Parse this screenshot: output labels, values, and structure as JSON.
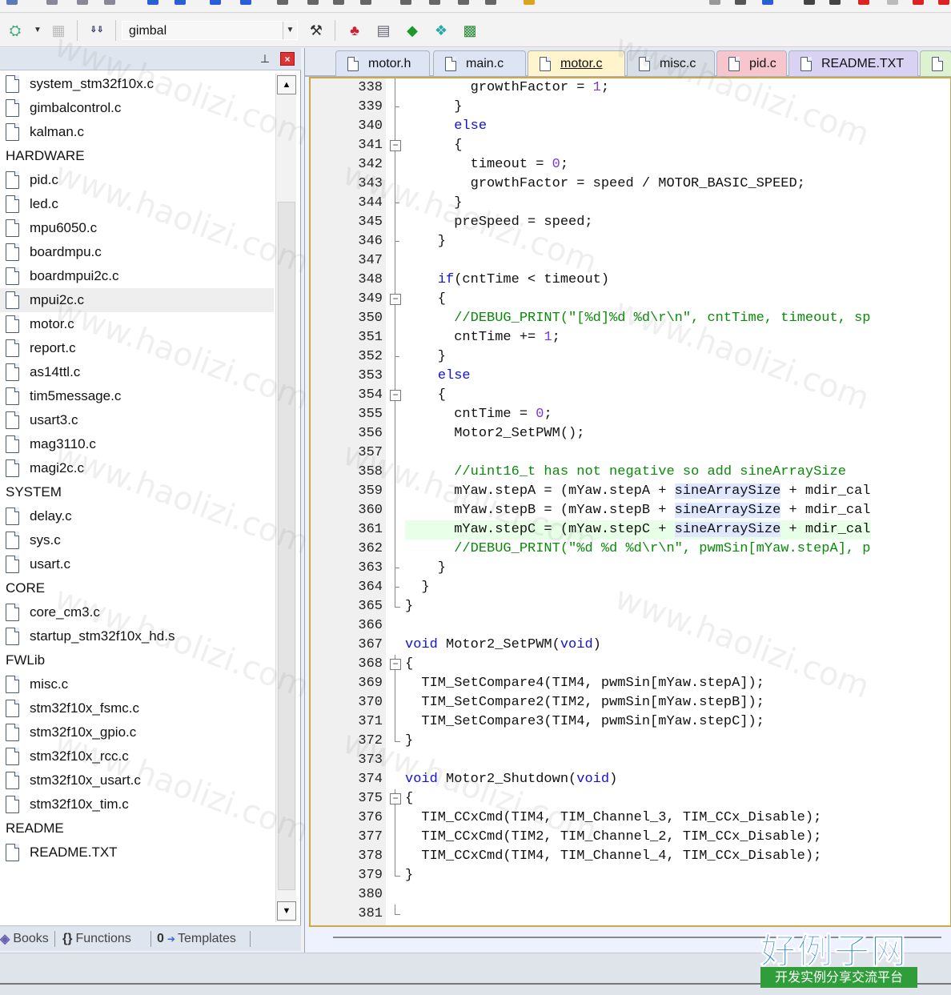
{
  "toolbar": {
    "target_name": "gimbal",
    "icons": [
      "build-options-icon",
      "load-icon",
      "magic-wand-icon",
      "rte-manage-icon",
      "pack-installer-icon",
      "select-device-icon",
      "packs-icon"
    ]
  },
  "project_panel": {
    "items": [
      {
        "type": "file",
        "label": "system_stm32f10x.c"
      },
      {
        "type": "file",
        "label": "gimbalcontrol.c"
      },
      {
        "type": "file",
        "label": "kalman.c"
      },
      {
        "type": "group",
        "label": "HARDWARE"
      },
      {
        "type": "file",
        "label": "pid.c"
      },
      {
        "type": "file",
        "label": "led.c"
      },
      {
        "type": "file",
        "label": "mpu6050.c"
      },
      {
        "type": "file",
        "label": "boardmpu.c"
      },
      {
        "type": "file",
        "label": "boardmpui2c.c"
      },
      {
        "type": "file",
        "label": "mpui2c.c",
        "selected": true
      },
      {
        "type": "file",
        "label": "motor.c"
      },
      {
        "type": "file",
        "label": "report.c"
      },
      {
        "type": "file",
        "label": "as14ttl.c"
      },
      {
        "type": "file",
        "label": "tim5message.c"
      },
      {
        "type": "file",
        "label": "usart3.c"
      },
      {
        "type": "file",
        "label": "mag3110.c"
      },
      {
        "type": "file",
        "label": "magi2c.c"
      },
      {
        "type": "group",
        "label": "SYSTEM"
      },
      {
        "type": "file",
        "label": "delay.c"
      },
      {
        "type": "file",
        "label": "sys.c"
      },
      {
        "type": "file",
        "label": "usart.c"
      },
      {
        "type": "group",
        "label": "CORE"
      },
      {
        "type": "file",
        "label": "core_cm3.c"
      },
      {
        "type": "file",
        "label": "startup_stm32f10x_hd.s"
      },
      {
        "type": "group",
        "label": "FWLib"
      },
      {
        "type": "file",
        "label": "misc.c"
      },
      {
        "type": "file",
        "label": "stm32f10x_fsmc.c"
      },
      {
        "type": "file",
        "label": "stm32f10x_gpio.c"
      },
      {
        "type": "file",
        "label": "stm32f10x_rcc.c"
      },
      {
        "type": "file",
        "label": "stm32f10x_usart.c"
      },
      {
        "type": "file",
        "label": "stm32f10x_tim.c"
      },
      {
        "type": "group",
        "label": "README"
      },
      {
        "type": "file",
        "label": "README.TXT"
      }
    ],
    "bottom_tabs": [
      {
        "label": "Books",
        "glyph": ""
      },
      {
        "label": "Functions",
        "glyph": "{}"
      },
      {
        "label": "Templates",
        "glyph": "0"
      }
    ]
  },
  "editor": {
    "tabs": [
      {
        "label": "motor.h",
        "color": "#dde5f5"
      },
      {
        "label": "main.c",
        "color": "#dde5f5"
      },
      {
        "label": "motor.c",
        "color": "#fff4cc",
        "active": true
      },
      {
        "label": "misc.c",
        "color": "#d8dde6"
      },
      {
        "label": "pid.c",
        "color": "#f6c6cc"
      },
      {
        "label": "README.TXT",
        "color": "#d9d2f2"
      },
      {
        "label": "",
        "color": "#dff2d0"
      }
    ],
    "lines": [
      {
        "n": "338",
        "fold": "line",
        "text": "        growthFactor = 1;"
      },
      {
        "n": "339",
        "fold": "tick",
        "text": "      }"
      },
      {
        "n": "340",
        "fold": "line",
        "text": "      else"
      },
      {
        "n": "341",
        "fold": "box",
        "text": "      {"
      },
      {
        "n": "342",
        "fold": "line",
        "text": "        timeout = 0;"
      },
      {
        "n": "343",
        "fold": "line",
        "text": "        growthFactor = speed / MOTOR_BASIC_SPEED;"
      },
      {
        "n": "344",
        "fold": "tick",
        "text": "      }"
      },
      {
        "n": "345",
        "fold": "line",
        "text": "      preSpeed = speed;"
      },
      {
        "n": "346",
        "fold": "tick",
        "text": "    }"
      },
      {
        "n": "347",
        "fold": "line",
        "text": ""
      },
      {
        "n": "348",
        "fold": "line",
        "text": "    if(cntTime < timeout)"
      },
      {
        "n": "349",
        "fold": "box",
        "text": "    {"
      },
      {
        "n": "350",
        "fold": "line",
        "text": "      //DEBUG_PRINT(\"[%d]%d %d\\r\\n\", cntTime, timeout, sp"
      },
      {
        "n": "351",
        "fold": "line",
        "text": "      cntTime += 1;"
      },
      {
        "n": "352",
        "fold": "tick",
        "text": "    }"
      },
      {
        "n": "353",
        "fold": "line",
        "text": "    else"
      },
      {
        "n": "354",
        "fold": "box",
        "text": "    {"
      },
      {
        "n": "355",
        "fold": "line",
        "text": "      cntTime = 0;"
      },
      {
        "n": "356",
        "fold": "line",
        "text": "      Motor2_SetPWM();"
      },
      {
        "n": "357",
        "fold": "line",
        "text": ""
      },
      {
        "n": "358",
        "fold": "line",
        "text": "      //uint16_t has not negative so add sineArraySize"
      },
      {
        "n": "359",
        "fold": "line",
        "text": "      mYaw.stepA = (mYaw.stepA + sineArraySize + mdir_cal"
      },
      {
        "n": "360",
        "fold": "line",
        "text": "      mYaw.stepB = (mYaw.stepB + sineArraySize + mdir_cal"
      },
      {
        "n": "361",
        "fold": "line",
        "text": "      mYaw.stepC = (mYaw.stepC + sineArraySize + mdir_cal",
        "highlight": true
      },
      {
        "n": "362",
        "fold": "line",
        "text": "      //DEBUG_PRINT(\"%d %d %d\\r\\n\", pwmSin[mYaw.stepA], p"
      },
      {
        "n": "363",
        "fold": "tick",
        "text": "    }"
      },
      {
        "n": "364",
        "fold": "tick",
        "text": "  }"
      },
      {
        "n": "365",
        "fold": "corner",
        "text": "}"
      },
      {
        "n": "366",
        "fold": "none",
        "text": ""
      },
      {
        "n": "367",
        "fold": "none",
        "text": "void Motor2_SetPWM(void)"
      },
      {
        "n": "368",
        "fold": "box",
        "text": "{"
      },
      {
        "n": "369",
        "fold": "line",
        "text": "  TIM_SetCompare4(TIM4, pwmSin[mYaw.stepA]);"
      },
      {
        "n": "370",
        "fold": "line",
        "text": "  TIM_SetCompare2(TIM2, pwmSin[mYaw.stepB]);"
      },
      {
        "n": "371",
        "fold": "line",
        "text": "  TIM_SetCompare3(TIM4, pwmSin[mYaw.stepC]);"
      },
      {
        "n": "372",
        "fold": "corner",
        "text": "}"
      },
      {
        "n": "373",
        "fold": "none",
        "text": ""
      },
      {
        "n": "374",
        "fold": "none",
        "text": "void Motor2_Shutdown(void)"
      },
      {
        "n": "375",
        "fold": "box",
        "text": "{"
      },
      {
        "n": "376",
        "fold": "line",
        "text": "  TIM_CCxCmd(TIM4, TIM_Channel_3, TIM_CCx_Disable);"
      },
      {
        "n": "377",
        "fold": "line",
        "text": "  TIM_CCxCmd(TIM2, TIM_Channel_2, TIM_CCx_Disable);"
      },
      {
        "n": "378",
        "fold": "line",
        "text": "  TIM_CCxCmd(TIM4, TIM_Channel_4, TIM_CCx_Disable);"
      },
      {
        "n": "379",
        "fold": "corner",
        "text": "}"
      },
      {
        "n": "380",
        "fold": "none",
        "text": ""
      },
      {
        "n": "381",
        "fold": "corner",
        "text": ""
      }
    ]
  },
  "watermark": {
    "text": "www.haolizi.com",
    "logo_title": "好例子网",
    "logo_subtitle": "开发实例分享交流平台"
  }
}
